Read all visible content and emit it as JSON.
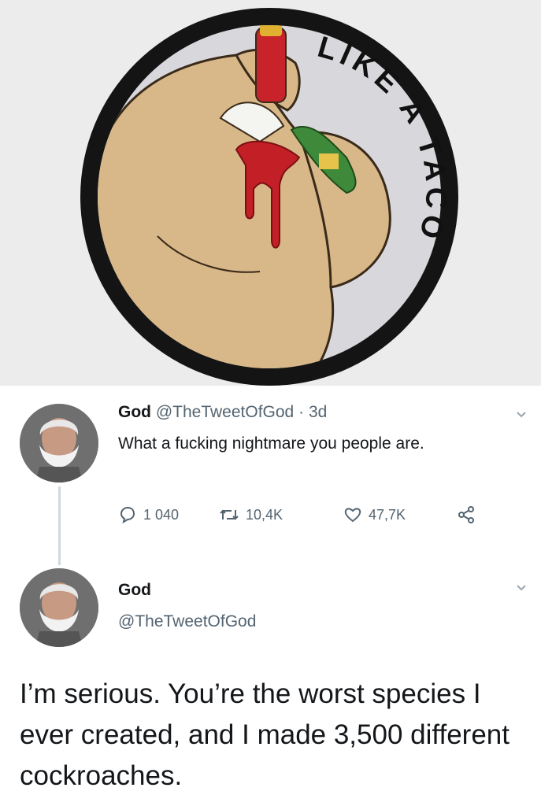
{
  "photo": {
    "patch_text": "LIKE A TACO"
  },
  "tweet1": {
    "name": "God",
    "handle": "@TheTweetOfGod",
    "separator": "·",
    "age": "3d",
    "text": "What a fucking nightmare you people are.",
    "replies": "1 040",
    "retweets": "10,4K",
    "likes": "47,7K"
  },
  "tweet2": {
    "name": "God",
    "handle": "@TheTweetOfGod",
    "text": "I’m serious. You’re the worst species I ever created, and I made 3,500 different cockroaches."
  },
  "colors": {
    "text": "#14171a",
    "muted": "#536471",
    "thread_line": "#cfd9de"
  }
}
